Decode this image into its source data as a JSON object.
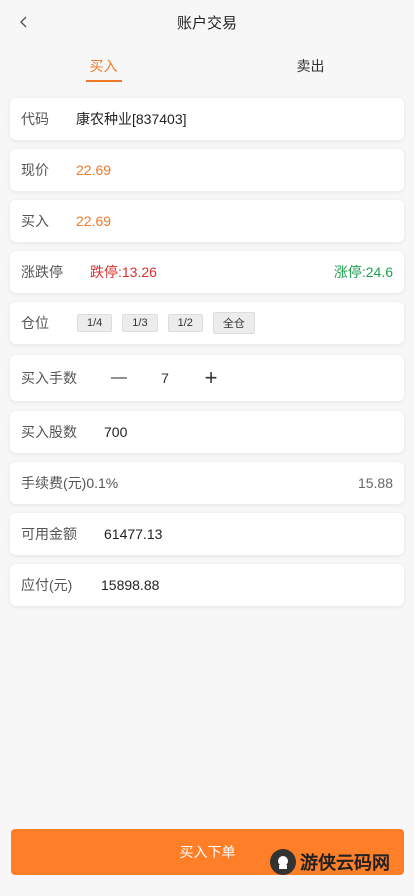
{
  "header": {
    "title": "账户交易"
  },
  "tabs": [
    {
      "label": "买入"
    },
    {
      "label": "卖出"
    }
  ],
  "form": {
    "code": {
      "label": "代码",
      "value": "康农种业[837403]"
    },
    "current_price": {
      "label": "现价",
      "value": "22.69"
    },
    "buy_price": {
      "label": "买入",
      "value": "22.69"
    },
    "limit": {
      "label": "涨跌停",
      "down": "跌停:13.26",
      "up": "涨停:24.6"
    },
    "position": {
      "label": "仓位",
      "options": [
        "1/4",
        "1/3",
        "1/2",
        "全仓"
      ]
    },
    "lots": {
      "label": "买入手数",
      "minus": "—",
      "value": "7",
      "plus": "+"
    },
    "shares": {
      "label": "买入股数",
      "value": "700"
    },
    "fee": {
      "label": "手续费(元)0.1%",
      "value": "15.88"
    },
    "available": {
      "label": "可用金额",
      "value": "61477.13"
    },
    "payable": {
      "label": "应付(元)",
      "value": "15898.88"
    }
  },
  "submit": {
    "label": "买入下单"
  },
  "watermark": {
    "text": "游侠云码网"
  },
  "colors": {
    "accent": "#f07a2a",
    "button": "#ff7f28",
    "down": "#d9302c",
    "up": "#1fa050"
  }
}
